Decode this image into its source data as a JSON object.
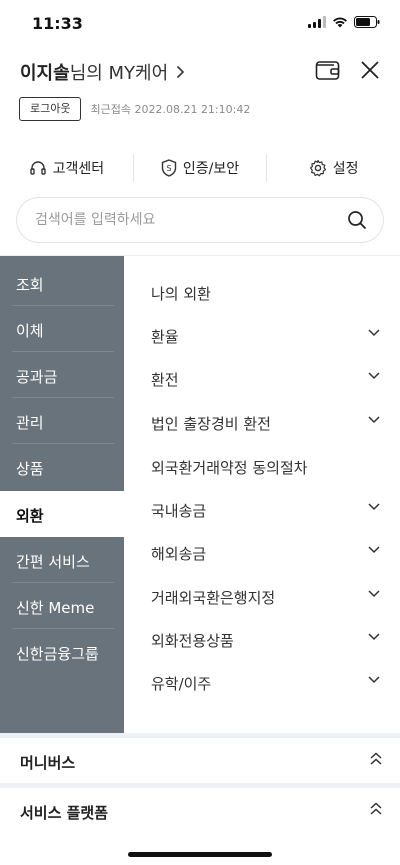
{
  "status_bar": {
    "time": "11:33"
  },
  "header": {
    "user_name": "이지솔",
    "title_rest": "님의 MY케어"
  },
  "session": {
    "logout_label": "로그아웃",
    "last_login": "최근접속 2022.08.21 21:10:42"
  },
  "quick_menu": [
    {
      "label": "고객센터",
      "icon": "headset-icon"
    },
    {
      "label": "인증/보안",
      "icon": "shield-icon"
    },
    {
      "label": "설정",
      "icon": "gear-icon"
    }
  ],
  "search": {
    "placeholder": "검색어를 입력하세요"
  },
  "sidebar": {
    "items": [
      {
        "label": "조회"
      },
      {
        "label": "이체"
      },
      {
        "label": "공과금"
      },
      {
        "label": "관리"
      },
      {
        "label": "상품"
      },
      {
        "label": "외환",
        "active": true
      },
      {
        "label": "간편 서비스"
      },
      {
        "label": "신한 Meme"
      },
      {
        "label": "신한금융그룹"
      }
    ]
  },
  "submenu": {
    "items": [
      {
        "label": "나의 외환",
        "expandable": false
      },
      {
        "label": "환율",
        "expandable": true
      },
      {
        "label": "환전",
        "expandable": true
      },
      {
        "label": "법인 출장경비 환전",
        "expandable": true
      },
      {
        "label": "외국환거래약정 동의절차",
        "expandable": false
      },
      {
        "label": "국내송금",
        "expandable": true
      },
      {
        "label": "해외송금",
        "expandable": true
      },
      {
        "label": "거래외국환은행지정",
        "expandable": true
      },
      {
        "label": "외화전용상품",
        "expandable": true
      },
      {
        "label": "유학/이주",
        "expandable": true
      }
    ]
  },
  "bottom_sections": [
    {
      "label": "머니버스"
    },
    {
      "label": "서비스 플랫폼"
    }
  ],
  "colors": {
    "sidebar_bg": "#69737c",
    "band": "#edf0f7"
  }
}
